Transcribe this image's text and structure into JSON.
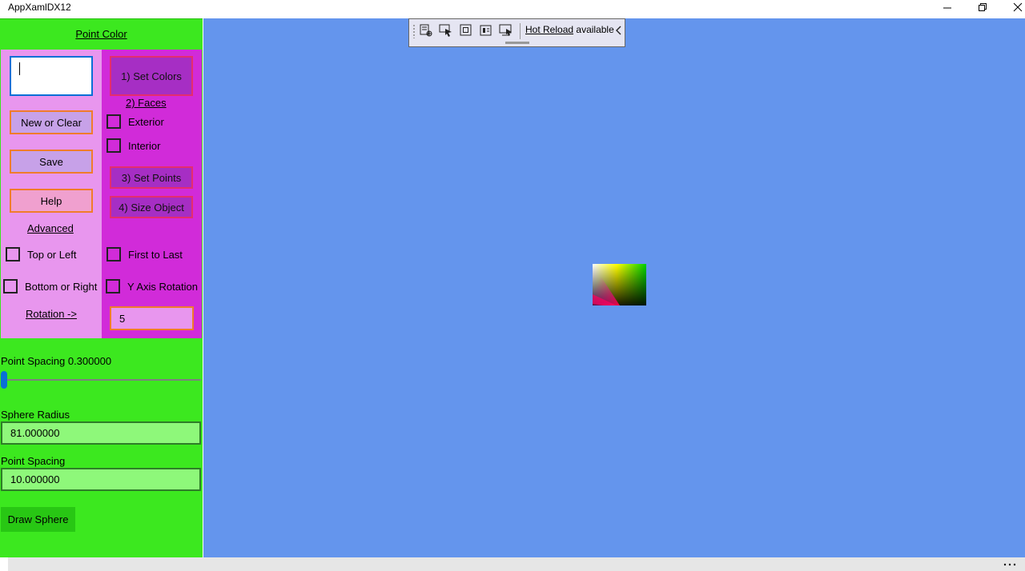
{
  "window": {
    "title": "AppXamlDX12"
  },
  "left_panel": {
    "point_color_link": "Point Color",
    "col_a": {
      "new_or_clear": "New or Clear",
      "save": "Save",
      "help": "Help",
      "advanced_link": "Advanced",
      "top_or_left": "Top or Left",
      "bottom_or_right": "Bottom or Right",
      "rotation_link": "Rotation ->"
    },
    "col_b": {
      "set_colors": "1) Set Colors",
      "faces_link": "2) Faces",
      "exterior": "Exterior",
      "interior": "Interior",
      "set_points": "3) Set Points",
      "size_object": "4) Size Object",
      "first_to_last": "First to Last",
      "y_axis_rotation": "Y Axis Rotation",
      "rotation_value": "5"
    },
    "slider": {
      "label": "Point Spacing 0.300000",
      "fraction": 0.0
    },
    "sphere_radius_label": "Sphere Radius",
    "sphere_radius_value": "81.000000",
    "point_spacing_label": "Point Spacing",
    "point_spacing_value": "10.000000",
    "draw_sphere": "Draw Sphere"
  },
  "hot_reload": {
    "link": "Hot Reload",
    "status": "available"
  },
  "colors": {
    "left_panel_bg": "#3ce81f",
    "col_a_bg": "#e896ee",
    "col_b_bg": "#d12bd9",
    "canvas_bg": "#6495ed",
    "accent": "#0a6fd6"
  },
  "icons": {
    "minimize": "minimize-icon",
    "restore": "restore-icon",
    "close": "close-icon",
    "more": "more-icon"
  }
}
